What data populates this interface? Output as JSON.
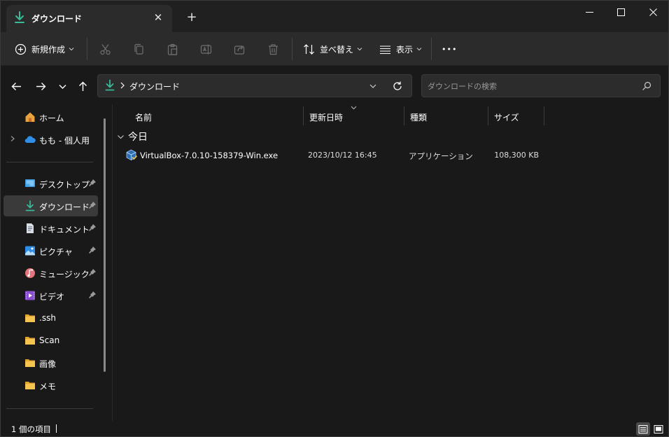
{
  "window": {
    "tab_title": "ダウンロード",
    "new_tab": "+",
    "tab_close": "✕"
  },
  "toolbar": {
    "new_label": "新規作成",
    "sort_label": "並べ替え",
    "view_label": "表示",
    "more_label": "•••",
    "icons": [
      "cut-icon",
      "copy-icon",
      "paste-icon",
      "rename-icon",
      "share-icon",
      "delete-icon"
    ]
  },
  "address": {
    "current": "ダウンロード",
    "search_placeholder": "ダウンロードの検索"
  },
  "sidebar": {
    "top": [
      {
        "label": "ホーム",
        "icon": "home-icon"
      },
      {
        "label": "もも - 個人用",
        "icon": "cloud-icon"
      }
    ],
    "pinned": [
      {
        "label": "デスクトップ",
        "icon": "desktop-icon"
      },
      {
        "label": "ダウンロード",
        "icon": "download-icon"
      },
      {
        "label": "ドキュメント",
        "icon": "documents-icon"
      },
      {
        "label": "ピクチャ",
        "icon": "pictures-icon"
      },
      {
        "label": "ミュージック",
        "icon": "music-icon"
      },
      {
        "label": "ビデオ",
        "icon": "videos-icon"
      }
    ],
    "folders": [
      {
        "label": ".ssh"
      },
      {
        "label": "Scan"
      },
      {
        "label": "画像"
      },
      {
        "label": "メモ"
      }
    ]
  },
  "columns": {
    "name": "名前",
    "modified": "更新日時",
    "type": "種類",
    "size": "サイズ"
  },
  "group": {
    "label": "今日"
  },
  "files": [
    {
      "name": "VirtualBox-7.0.10-158379-Win.exe",
      "modified": "2023/10/12 16:45",
      "type": "アプリケーション",
      "size": "108,300 KB"
    }
  ],
  "status": {
    "item_count": "1 個の項目"
  },
  "colors": {
    "accent_download": "#3ab99b",
    "folder": "#f4c44e",
    "background": "#191919",
    "command_bar": "#2b2b2b"
  }
}
